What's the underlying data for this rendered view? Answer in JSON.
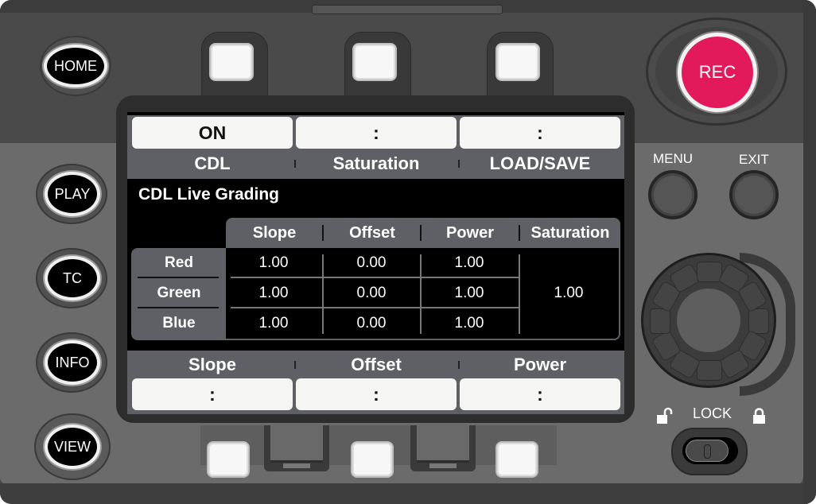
{
  "device": {
    "left_buttons": [
      {
        "id": "home",
        "label": "HOME"
      },
      {
        "id": "play",
        "label": "PLAY"
      },
      {
        "id": "tc",
        "label": "TC"
      },
      {
        "id": "info",
        "label": "INFO"
      },
      {
        "id": "view",
        "label": "VIEW"
      }
    ],
    "rec_label": "REC",
    "menu_label": "MENU",
    "exit_label": "EXIT",
    "lock_label": "LOCK",
    "colors": {
      "rec": "#e2195a",
      "panel": "#4a4a4a",
      "screen_bar": "#5e6065"
    }
  },
  "screen": {
    "top_function_keys": [
      {
        "value": "ON",
        "label": "CDL"
      },
      {
        "value": ":",
        "label": "Saturation"
      },
      {
        "value": ":",
        "label": "LOAD/SAVE"
      }
    ],
    "title": "CDL Live Grading",
    "table": {
      "columns": [
        "Slope",
        "Offset",
        "Power",
        "Saturation"
      ],
      "rows": [
        {
          "channel": "Red",
          "slope": "1.00",
          "offset": "0.00",
          "power": "1.00"
        },
        {
          "channel": "Green",
          "slope": "1.00",
          "offset": "0.00",
          "power": "1.00"
        },
        {
          "channel": "Blue",
          "slope": "1.00",
          "offset": "0.00",
          "power": "1.00"
        }
      ],
      "saturation": "1.00"
    },
    "bottom_function_keys": [
      {
        "label": "Slope",
        "value": ":"
      },
      {
        "label": "Offset",
        "value": ":"
      },
      {
        "label": "Power",
        "value": ":"
      }
    ]
  }
}
